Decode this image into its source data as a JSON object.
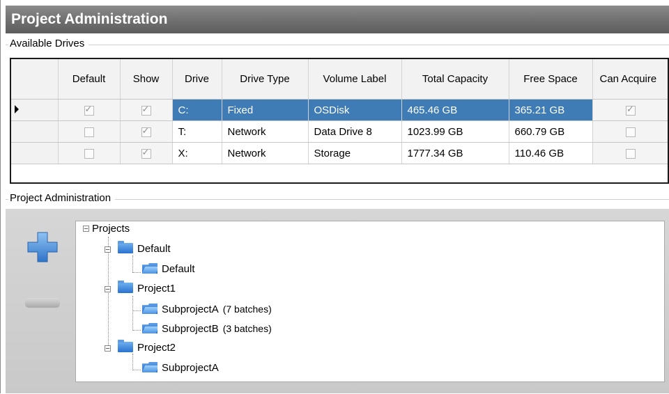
{
  "window": {
    "title": "Project Administration"
  },
  "drives": {
    "group_label": "Available Drives",
    "columns": [
      "Default",
      "Show",
      "Drive",
      "Drive Type",
      "Volume Label",
      "Total Capacity",
      "Free Space",
      "Can Acquire"
    ],
    "rows": [
      {
        "default": true,
        "show": true,
        "drive": "C:",
        "drive_type": "Fixed",
        "volume_label": "OSDisk",
        "total_capacity": "465.46 GB",
        "free_space": "365.21 GB",
        "can_acquire": true,
        "selected": true
      },
      {
        "default": false,
        "show": true,
        "drive": "T:",
        "drive_type": "Network",
        "volume_label": "Data Drive 8",
        "total_capacity": "1023.99 GB",
        "free_space": "660.79 GB",
        "can_acquire": false,
        "selected": false
      },
      {
        "default": false,
        "show": true,
        "drive": "X:",
        "drive_type": "Network",
        "volume_label": "Storage",
        "total_capacity": "1777.34 GB",
        "free_space": "110.46 GB",
        "can_acquire": false,
        "selected": false
      }
    ]
  },
  "projects": {
    "group_label": "Project Administration",
    "add_icon": "plus-icon",
    "remove_icon": "minus-icon",
    "tree": {
      "root": "Projects",
      "children": [
        {
          "name": "Default",
          "children": [
            {
              "name": "Default",
              "batches": ""
            }
          ]
        },
        {
          "name": "Project1",
          "children": [
            {
              "name": "SubprojectA",
              "batches": "(7 batches)"
            },
            {
              "name": "SubprojectB",
              "batches": "(3 batches)"
            }
          ]
        },
        {
          "name": "Project2",
          "children": [
            {
              "name": "SubprojectA",
              "batches": ""
            }
          ]
        }
      ]
    }
  },
  "colors": {
    "selection": "#3f7cb6",
    "title_bar": "#6f6f6f",
    "panel": "#cfcfcf"
  }
}
